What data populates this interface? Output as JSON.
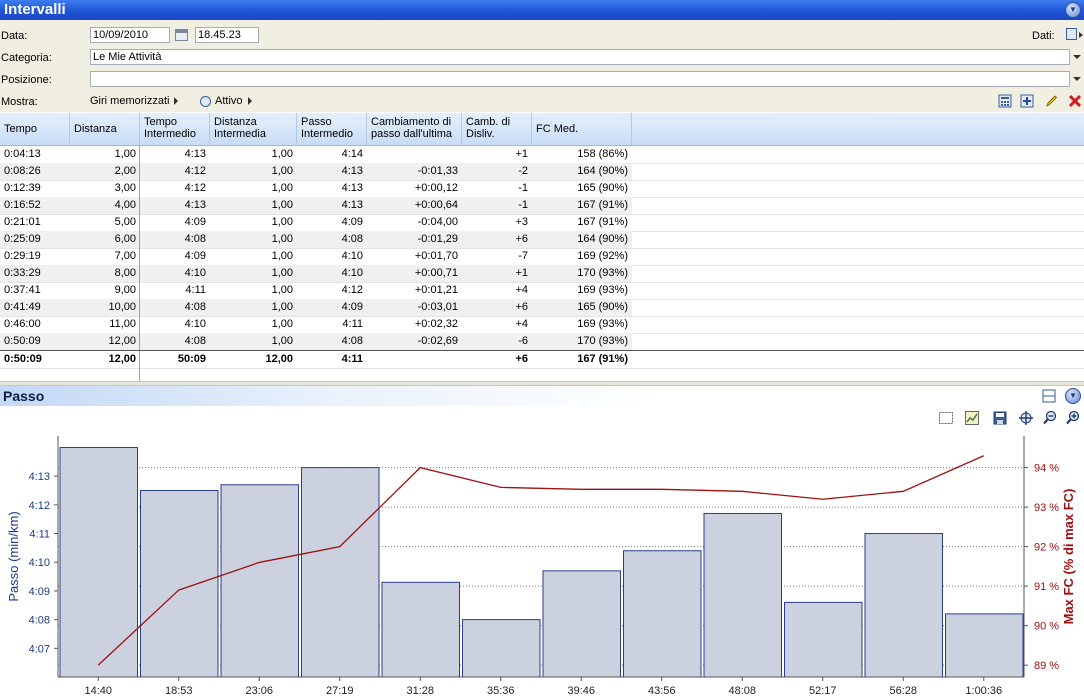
{
  "window": {
    "title": "Intervalli"
  },
  "form": {
    "data_label": "Data:",
    "date_value": "10/09/2010",
    "time_value": "18.45.23",
    "dati_label": "Dati:",
    "categoria_label": "Categoria:",
    "categoria_value": "Le Mie Attività",
    "posizione_label": "Posizione:",
    "posizione_value": "",
    "mostra_label": "Mostra:",
    "mostra_giri": "Giri memorizzati",
    "mostra_attivo": "Attivo"
  },
  "grid": {
    "columns": [
      "Tempo",
      "Distanza",
      "Tempo\nIntermedio",
      "Distanza\nIntermedia",
      "Passo\nIntermedio",
      "Cambiamento di\npasso dall'ultima",
      "Camb. di\nDisliv.",
      "FC Med."
    ],
    "rows": [
      [
        "0:04:13",
        "1,00",
        "4:13",
        "1,00",
        "4:14",
        "",
        "+1",
        "158 (86%)"
      ],
      [
        "0:08:26",
        "2,00",
        "4:12",
        "1,00",
        "4:13",
        "-0:01,33",
        "-2",
        "164 (90%)"
      ],
      [
        "0:12:39",
        "3,00",
        "4:12",
        "1,00",
        "4:13",
        "+0:00,12",
        "-1",
        "165 (90%)"
      ],
      [
        "0:16:52",
        "4,00",
        "4:13",
        "1,00",
        "4:13",
        "+0:00,64",
        "-1",
        "167 (91%)"
      ],
      [
        "0:21:01",
        "5,00",
        "4:09",
        "1,00",
        "4:09",
        "-0:04,00",
        "+3",
        "167 (91%)"
      ],
      [
        "0:25:09",
        "6,00",
        "4:08",
        "1,00",
        "4:08",
        "-0:01,29",
        "+6",
        "164 (90%)"
      ],
      [
        "0:29:19",
        "7,00",
        "4:09",
        "1,00",
        "4:10",
        "+0:01,70",
        "-7",
        "169 (92%)"
      ],
      [
        "0:33:29",
        "8,00",
        "4:10",
        "1,00",
        "4:10",
        "+0:00,71",
        "+1",
        "170 (93%)"
      ],
      [
        "0:37:41",
        "9,00",
        "4:11",
        "1,00",
        "4:12",
        "+0:01,21",
        "+4",
        "169 (93%)"
      ],
      [
        "0:41:49",
        "10,00",
        "4:08",
        "1,00",
        "4:09",
        "-0:03,01",
        "+6",
        "165 (90%)"
      ],
      [
        "0:46:00",
        "11,00",
        "4:10",
        "1,00",
        "4:11",
        "+0:02,32",
        "+4",
        "169 (93%)"
      ],
      [
        "0:50:09",
        "12,00",
        "4:08",
        "1,00",
        "4:08",
        "-0:02,69",
        "-6",
        "170 (93%)"
      ]
    ],
    "total": [
      "0:50:09",
      "12,00",
      "50:09",
      "12,00",
      "4:11",
      "",
      "+6",
      "167 (91%)"
    ]
  },
  "chart_panel": {
    "title": "Passo"
  },
  "chart_data": {
    "type": "bar",
    "categories": [
      "14:40",
      "18:53",
      "23:06",
      "27:19",
      "31:28",
      "35:36",
      "39:46",
      "43:56",
      "48:08",
      "52:17",
      "56:28",
      "1:00:36"
    ],
    "series": [
      {
        "name": "Passo (min/km)",
        "type": "bar",
        "axis": "left",
        "values": [
          "4:14",
          "4:12.5",
          "4:12.7",
          "4:13.3",
          "4:09.3",
          "4:08",
          "4:09.7",
          "4:10.4",
          "4:11.7",
          "4:08.6",
          "4:11",
          "4:08.2"
        ]
      },
      {
        "name": "Max FC (% di max FC)",
        "type": "line",
        "axis": "right",
        "values": [
          89,
          90.9,
          91.6,
          92,
          94,
          93.5,
          93.45,
          93.45,
          93.4,
          93.2,
          93.4,
          94.3
        ]
      }
    ],
    "ylabel": "Passo (min/km)",
    "ylabel_right": "Max FC (% di max FC)",
    "yticks_left": [
      "4:07",
      "4:08",
      "4:09",
      "4:10",
      "4:11",
      "4:12",
      "4:13"
    ],
    "yticks_right": [
      "89 %",
      "90 %",
      "91 %",
      "92 %",
      "93 %",
      "94 %"
    ],
    "ylim_left_seconds": [
      246,
      254.4
    ],
    "ylim_right": [
      88.7,
      94.8
    ],
    "grid": true,
    "colors": {
      "bar_fill": "#cbd1de",
      "bar_stroke": "#2b3f8c",
      "line": "#a01010",
      "left_axis": "#1c3a8a",
      "right_axis": "#a01010"
    }
  }
}
